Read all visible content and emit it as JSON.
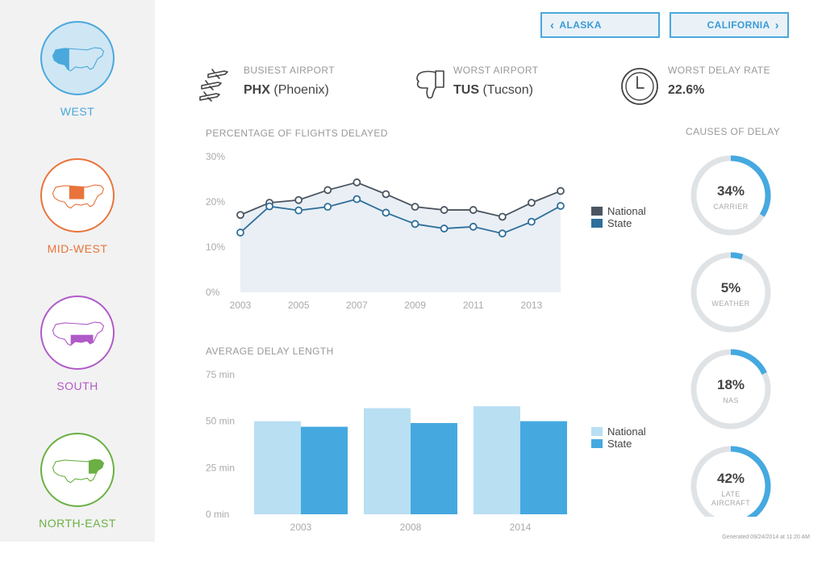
{
  "sidebar": {
    "regions": [
      {
        "name": "WEST",
        "color": "#4aa8dc",
        "fill": "#cfe6f4",
        "active": true
      },
      {
        "name": "MID-WEST",
        "color": "#e8743b",
        "fill": "#ffffff",
        "active": false
      },
      {
        "name": "SOUTH",
        "color": "#b05ac8",
        "fill": "#ffffff",
        "active": false
      },
      {
        "name": "NORTH-EAST",
        "color": "#6ab043",
        "fill": "#ffffff",
        "active": false
      }
    ]
  },
  "nav": {
    "prev_label": "ALASKA",
    "next_label": "CALIFORNIA"
  },
  "stats": {
    "busiest": {
      "label": "BUSIEST AIRPORT",
      "code": "PHX",
      "city": "(Phoenix)",
      "icon": "airplanes-icon"
    },
    "worst": {
      "label": "WORST AIRPORT",
      "code": "TUS",
      "city": "(Tucson)",
      "icon": "thumbs-down-icon"
    },
    "delay_rate": {
      "label": "WORST DELAY RATE",
      "value": "22.6%",
      "icon": "clock-icon"
    }
  },
  "chart_data": [
    {
      "type": "area",
      "title": "PERCENTAGE OF FLIGHTS DELAYED",
      "x": [
        2003,
        2004,
        2005,
        2006,
        2007,
        2008,
        2009,
        2010,
        2011,
        2012,
        2013,
        2014
      ],
      "xticks": [
        "2003",
        "2005",
        "2007",
        "2009",
        "2011",
        "2013"
      ],
      "yticks": [
        "30%",
        "20%",
        "10%",
        "0%"
      ],
      "ylim": [
        0,
        30
      ],
      "series": [
        {
          "name": "National",
          "color": "#4a5561",
          "values": [
            17.1,
            19.8,
            20.4,
            22.6,
            24.3,
            21.7,
            18.9,
            18.2,
            18.2,
            16.7,
            19.8,
            22.4
          ]
        },
        {
          "name": "State",
          "color": "#2f6f9a",
          "values": [
            13.2,
            19.0,
            18.1,
            18.9,
            20.6,
            17.6,
            15.1,
            14.1,
            14.5,
            13.0,
            15.6,
            19.1
          ]
        }
      ]
    },
    {
      "type": "bar",
      "title": "AVERAGE DELAY LENGTH",
      "categories": [
        "2003",
        "2008",
        "2014"
      ],
      "yticks": [
        "75 min",
        "50 min",
        "25 min",
        "0 min"
      ],
      "ylim": [
        0,
        75
      ],
      "series": [
        {
          "name": "National",
          "color": "#b9dff2",
          "values": [
            50,
            57,
            58
          ]
        },
        {
          "name": "State",
          "color": "#45a9e0",
          "values": [
            47,
            49,
            50
          ]
        }
      ]
    },
    {
      "type": "pie",
      "title": "CAUSES OF DELAY",
      "items": [
        {
          "value": 34,
          "text": "34%",
          "label": [
            "CARRIER"
          ]
        },
        {
          "value": 5,
          "text": "5%",
          "label": [
            "WEATHER"
          ]
        },
        {
          "value": 18,
          "text": "18%",
          "label": [
            "NAS"
          ]
        },
        {
          "value": 42,
          "text": "42%",
          "label": [
            "LATE",
            "AIRCRAFT"
          ]
        }
      ]
    }
  ],
  "footer": "Generated 09/24/2014 at 11:20 AM"
}
